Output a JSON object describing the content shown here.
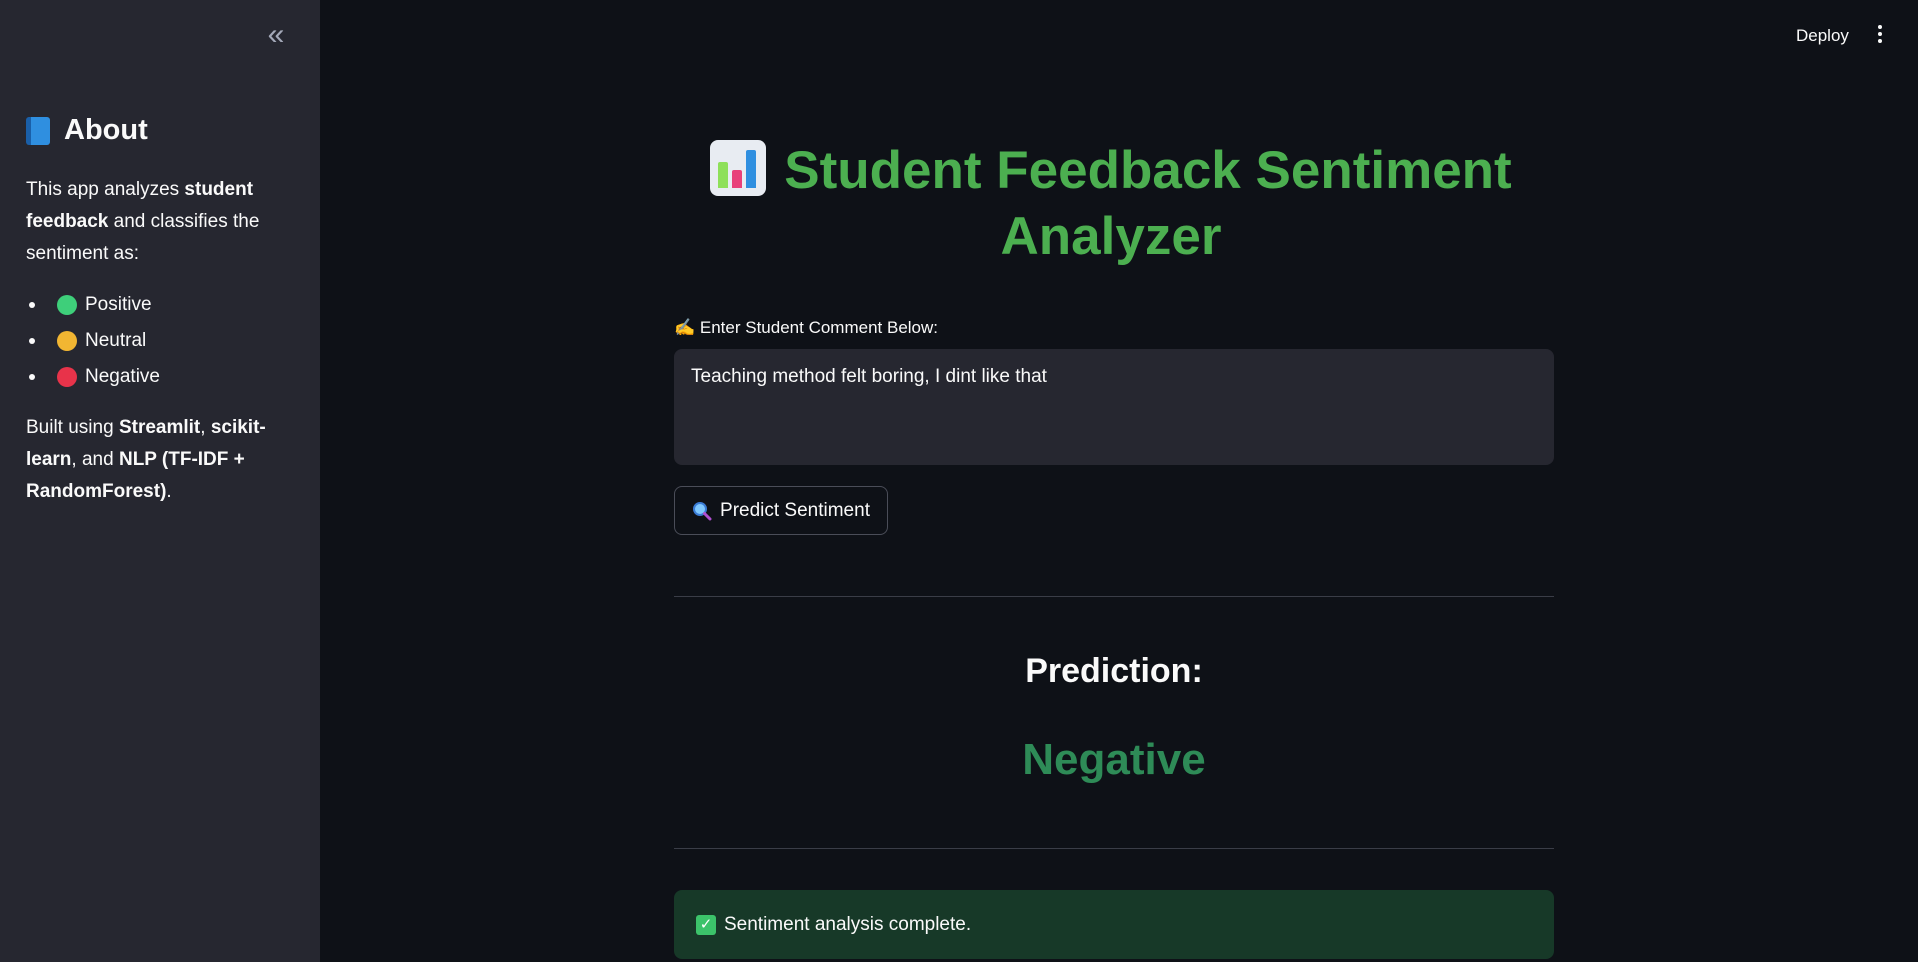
{
  "sidebar": {
    "collapse_icon": "double-chevron-left-icon",
    "title": "About",
    "title_icon": "book-icon",
    "intro": {
      "t1": "This app analyzes ",
      "b1": "student feedback",
      "t2": " and classifies the sentiment as:"
    },
    "items": [
      {
        "label": "Positive",
        "color": "#3ecf7a"
      },
      {
        "label": "Neutral",
        "color": "#f2b632"
      },
      {
        "label": "Negative",
        "color": "#e8334a"
      }
    ],
    "built": {
      "t1": "Built using ",
      "b1": "Streamlit",
      "t2": ", ",
      "b2": "scikit-learn",
      "t3": ", and ",
      "b3": "NLP (TF-IDF + RandomForest)",
      "t4": "."
    }
  },
  "header": {
    "deploy_label": "Deploy",
    "menu_icon": "kebab-menu-icon"
  },
  "main": {
    "title": "Student Feedback Sentiment Analyzer",
    "title_icon": "bar-chart-icon",
    "input_label": "✍️ Enter Student Comment Below:",
    "comment_value": "Teaching method felt boring, I dint like that",
    "predict_button": "Predict Sentiment",
    "predict_icon": "magnifier-icon",
    "prediction_label": "Prediction:",
    "prediction_value": "Negative",
    "success_message": "Sentiment analysis complete.",
    "success_icon": "check-icon"
  },
  "colors": {
    "accent_title": "#4caf50",
    "prediction": "#2e8b57",
    "success_bg": "#173928"
  }
}
